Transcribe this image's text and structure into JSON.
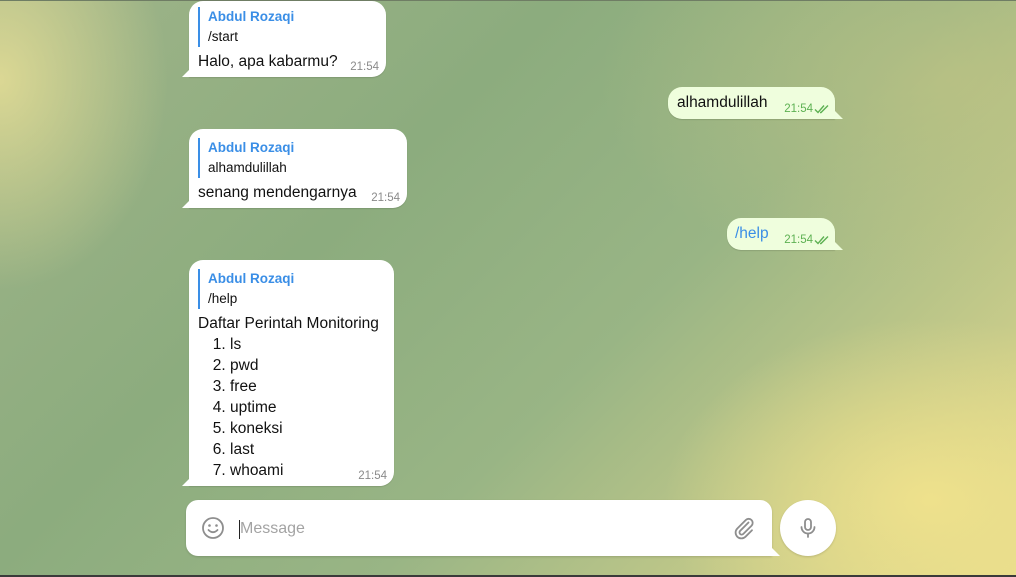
{
  "messages": [
    {
      "type": "in",
      "reply_name": "Abdul Rozaqi",
      "reply_text": "/start",
      "text": "Halo, apa kabarmu?",
      "time": "21:54"
    },
    {
      "type": "out",
      "text": "alhamdulillah",
      "time": "21:54"
    },
    {
      "type": "in",
      "reply_name": "Abdul Rozaqi",
      "reply_text": "alhamdulillah",
      "text": "senang mendengarnya",
      "time": "21:54"
    },
    {
      "type": "out",
      "text": "/help",
      "time": "21:54"
    },
    {
      "type": "in",
      "reply_name": "Abdul Rozaqi",
      "reply_text": "/help",
      "text": "Daftar Perintah Monitoring",
      "list": [
        "ls",
        "pwd",
        "free",
        "uptime",
        "koneksi",
        "last",
        "whoami"
      ],
      "time": "21:54"
    }
  ],
  "composer": {
    "placeholder": "Message"
  },
  "icons": {
    "emoji": "smiley-icon",
    "attach": "paperclip-icon",
    "mic": "microphone-icon",
    "read": "double-check-icon"
  },
  "colors": {
    "accent": "#3a8ee6",
    "outgoing_bubble": "#effedd",
    "read_ticks": "#5db152"
  }
}
